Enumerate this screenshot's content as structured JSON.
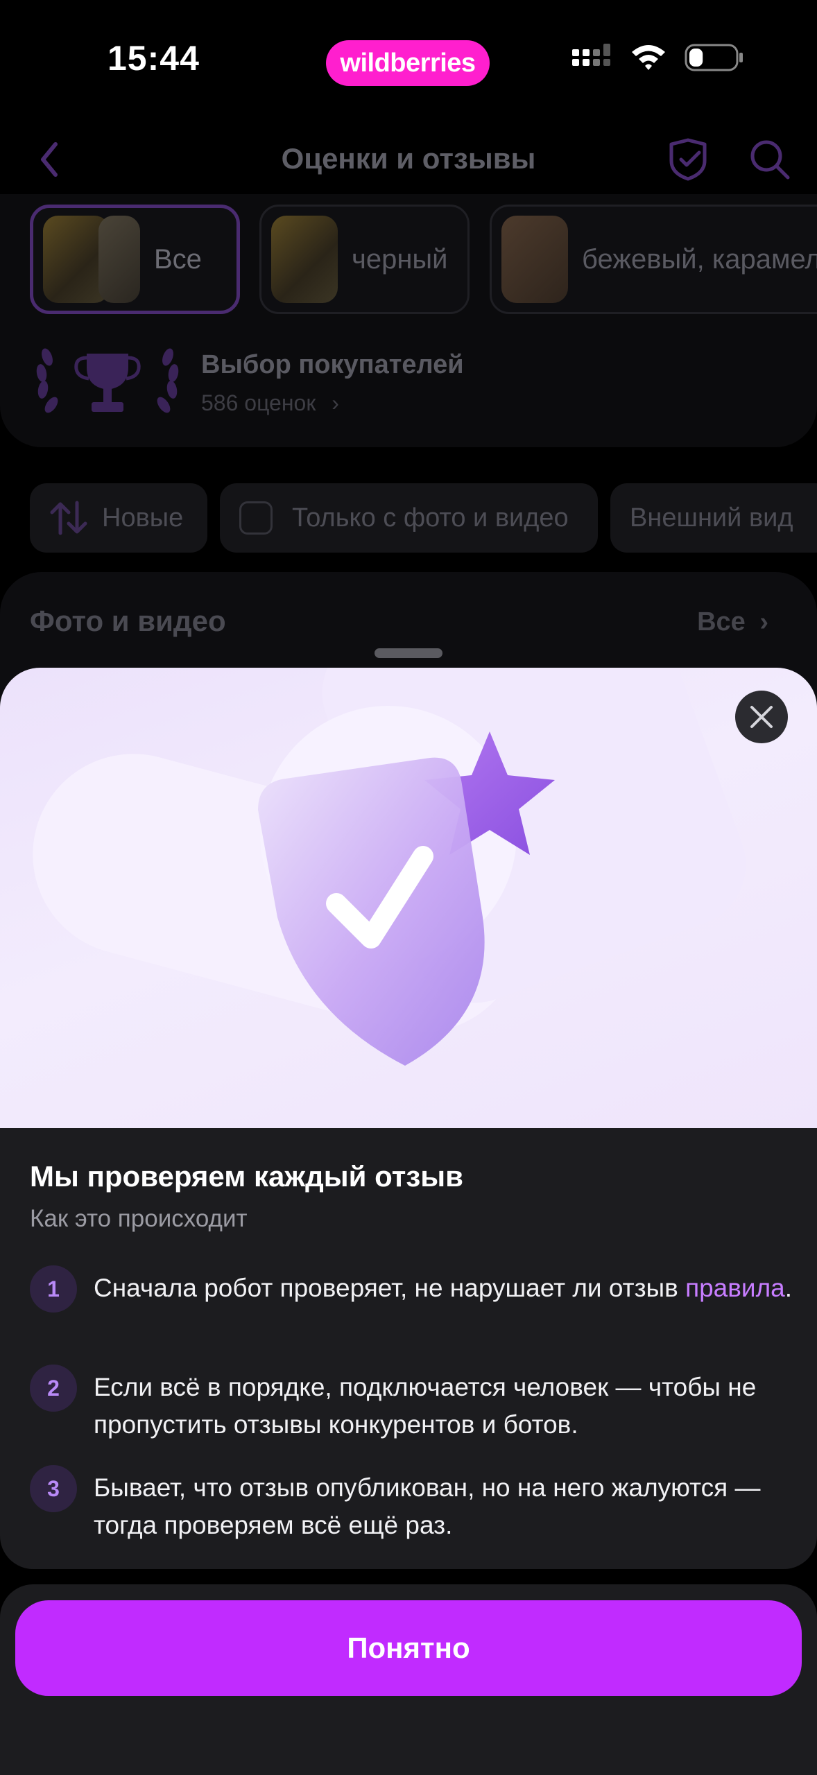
{
  "status_bar": {
    "time": "15:44",
    "brand": "wildberries",
    "icons": [
      "cellular-signal-icon",
      "wifi-icon",
      "battery-icon"
    ],
    "battery_level": 0.3
  },
  "background_page": {
    "title": "Оценки и отзывы",
    "variants": [
      {
        "label": "Все",
        "selected": true
      },
      {
        "label": "черный",
        "selected": false
      },
      {
        "label": "бежевый, карамель",
        "selected": false
      }
    ],
    "customer_choice": {
      "title": "Выбор покупателей",
      "ratings": "586 оценок"
    },
    "filters": [
      {
        "label": "Новые",
        "icon": "sort-icon"
      },
      {
        "label": "Только с фото и видео",
        "icon": "checkbox"
      },
      {
        "label": "Внешний вид",
        "icon": ""
      }
    ],
    "section": {
      "title": "Фото и видео",
      "all_link": "Все"
    }
  },
  "sheet": {
    "title": "Мы проверяем каждый отзыв",
    "subtitle": "Как это происходит",
    "steps": [
      {
        "num": "1",
        "text": "Сначала робот проверяет, не нарушает ли отзыв ",
        "link": "правила",
        "after": "."
      },
      {
        "num": "2",
        "text": "Если всё в порядке, подключается человек — чтобы не пропустить отзывы конкурентов и ботов."
      },
      {
        "num": "3",
        "text": "Бывает, что отзыв опубликован, но на него жалуются — тогда проверяем всё ещё раз."
      }
    ],
    "primary_button": "Понятно"
  },
  "colors": {
    "accent": "#c12bff",
    "brand_pill": "#ff1fce",
    "link": "#c77dff",
    "sheet_bg": "#1c1c1f"
  }
}
